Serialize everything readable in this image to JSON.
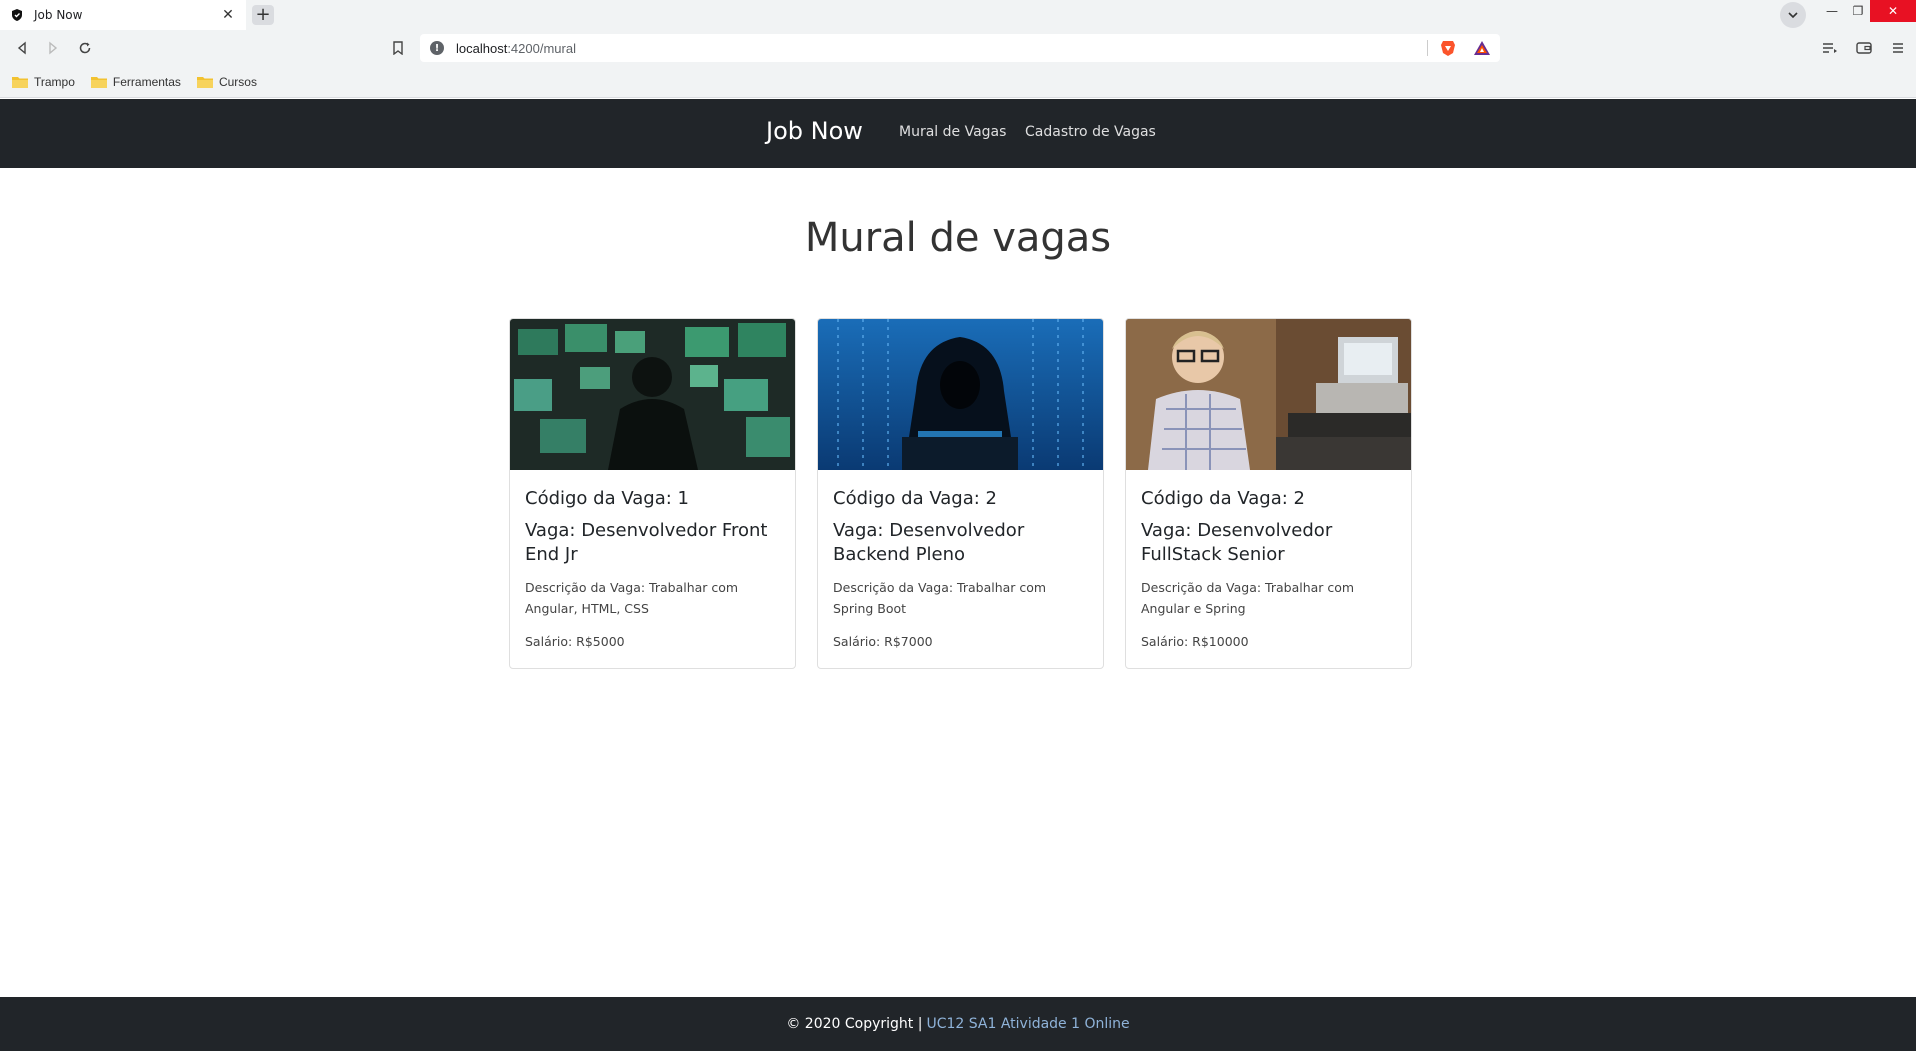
{
  "browser": {
    "tab_title": "Job Now",
    "tab_close": "✕",
    "new_tab": "+",
    "url_host": "localhost",
    "url_path": ":4200/mural",
    "window_min": "—",
    "window_restore": "❐",
    "window_close": "✕",
    "bookmarks": [
      {
        "label": "Trampo"
      },
      {
        "label": "Ferramentas"
      },
      {
        "label": "Cursos"
      }
    ]
  },
  "nav": {
    "brand": "Job Now",
    "links": [
      {
        "label": "Mural de Vagas"
      },
      {
        "label": "Cadastro de Vagas"
      }
    ]
  },
  "main": {
    "title": "Mural de vagas"
  },
  "cards": [
    {
      "code": "Código da Vaga: 1",
      "vaga": "Vaga: Desenvolvedor Front End Jr",
      "desc": "Descrição da Vaga: Trabalhar com Angular, HTML, CSS",
      "salary": "Salário: R$5000"
    },
    {
      "code": "Código da Vaga: 2",
      "vaga": "Vaga: Desenvolvedor Backend Pleno",
      "desc": "Descrição da Vaga: Trabalhar com Spring Boot",
      "salary": "Salário: R$7000"
    },
    {
      "code": "Código da Vaga: 2",
      "vaga": "Vaga: Desenvolvedor FullStack Senior",
      "desc": "Descrição da Vaga: Trabalhar com Angular e Spring",
      "salary": "Salário: R$10000"
    }
  ],
  "footer": {
    "copyright": "© 2020 Copyright |",
    "link": "UC12 SA1 Atividade 1 Online"
  },
  "colors": {
    "navbar": "#212529",
    "footer": "#212529",
    "footer_link": "#8fb3d9"
  }
}
